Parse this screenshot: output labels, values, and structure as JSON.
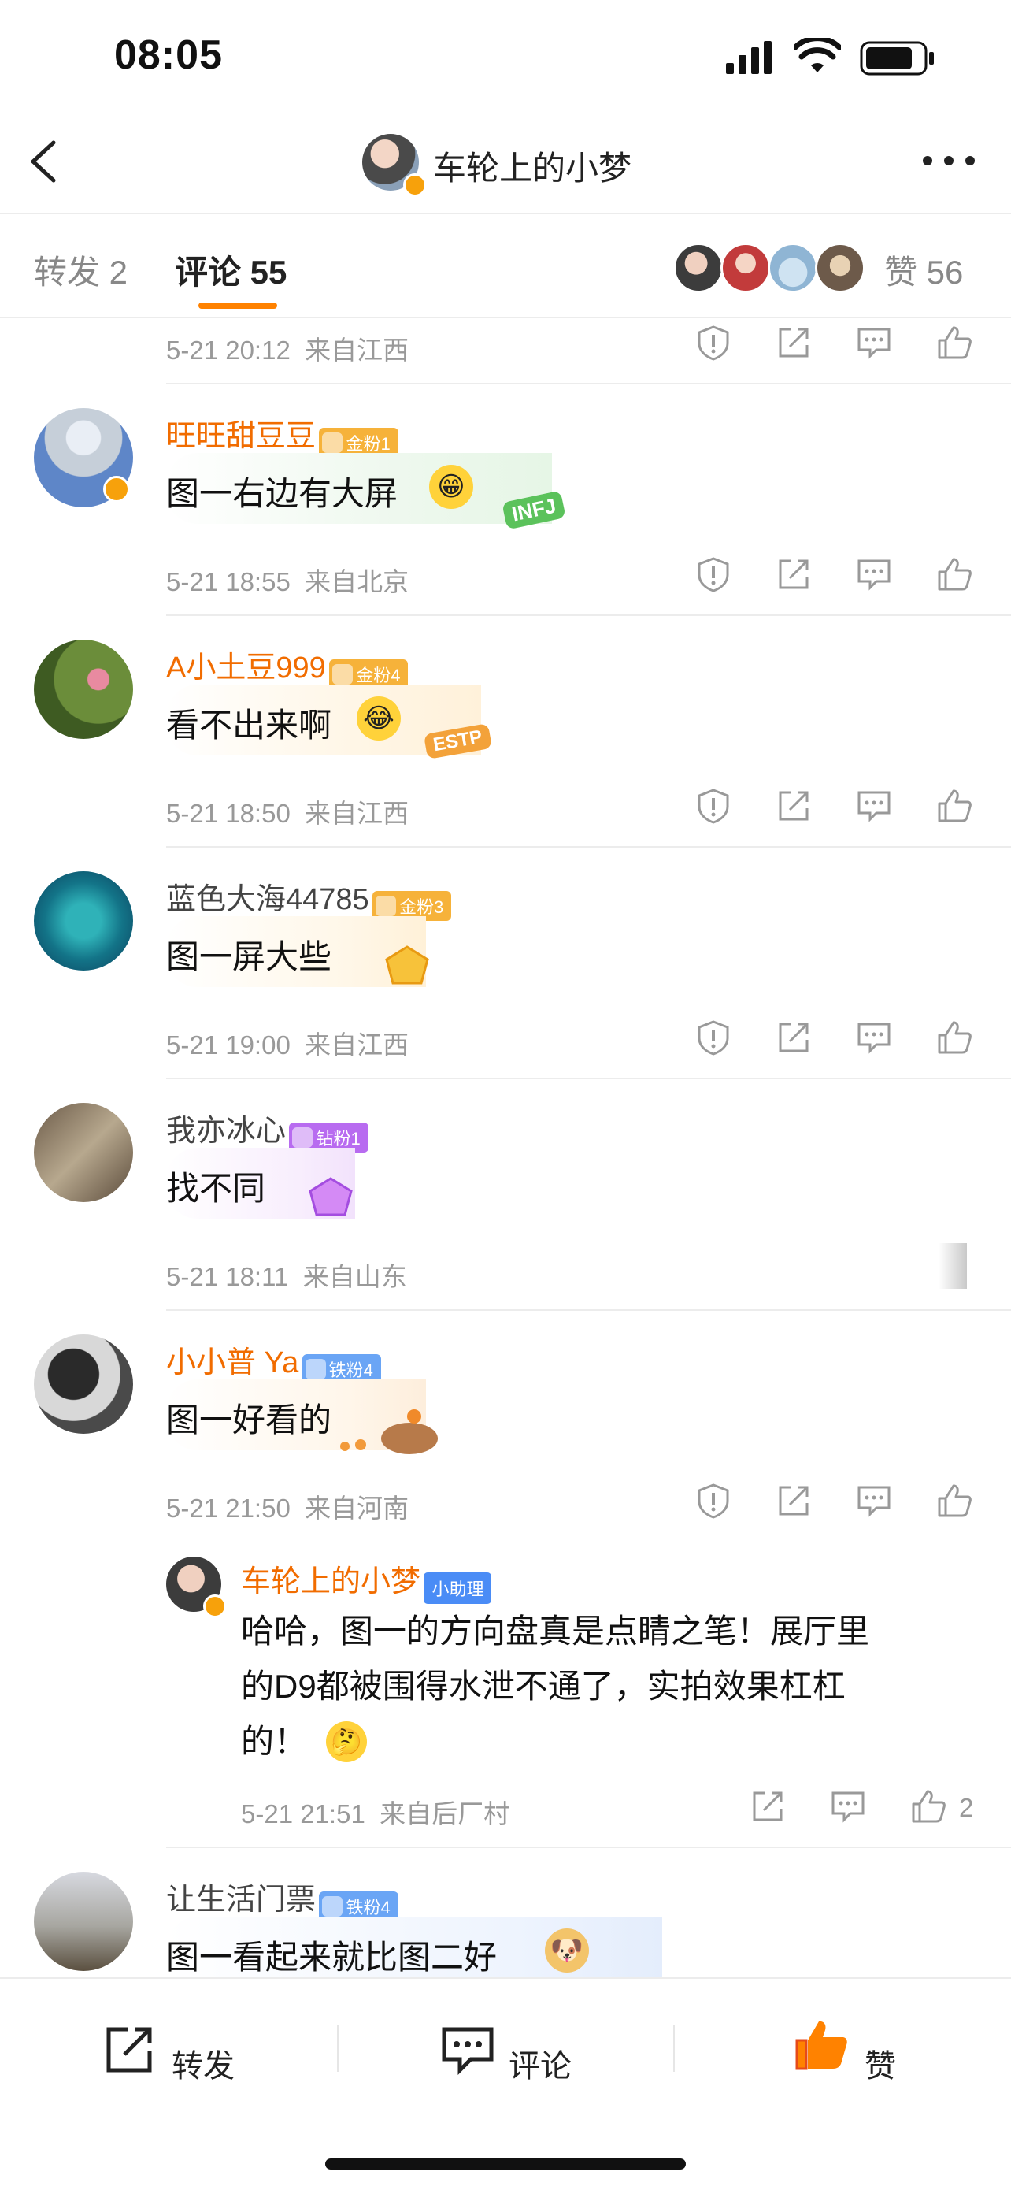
{
  "status": {
    "time": "08:05"
  },
  "header": {
    "title": "车轮上的小梦",
    "back_icon": "chevron-left-icon",
    "more_icon": "more-dots-icon"
  },
  "tabs": [
    {
      "label": "转发 2",
      "active": false
    },
    {
      "label": "评论 55",
      "active": true
    }
  ],
  "likes": {
    "label": "赞 56"
  },
  "top_meta": {
    "time": "5-21 20:12",
    "location": "来自江西"
  },
  "comments": [
    {
      "user": "旺旺甜豆豆",
      "name_color": "orange",
      "badge": "金粉1",
      "text": "图一右边有大屏",
      "emoji": "grinning-face-icon",
      "sticker": "INFJ",
      "time": "5-21 18:55",
      "location": "来自北京"
    },
    {
      "user": "A小土豆999",
      "name_color": "orange",
      "badge": "金粉4",
      "text": "看不出来啊",
      "emoji": "laughing-crying-face-icon",
      "sticker": "ESTP",
      "time": "5-21 18:50",
      "location": "来自江西"
    },
    {
      "user": "蓝色大海44785",
      "name_color": "gray",
      "badge": "金粉3",
      "text": "图一屏大些",
      "emoji": "",
      "sticker": "",
      "time": "5-21 19:00",
      "location": "来自江西"
    },
    {
      "user": "我亦冰心",
      "name_color": "gray",
      "badge": "钻粉1",
      "text": "找不同",
      "emoji": "",
      "sticker": "",
      "time": "5-21 18:11",
      "location": "来自山东"
    },
    {
      "user": "小小普 Ya",
      "name_color": "orange",
      "badge": "铁粉4",
      "text": "图一好看的",
      "emoji": "",
      "sticker": "",
      "time": "5-21 21:50",
      "location": "来自河南"
    },
    {
      "user": "让生活门票",
      "name_color": "gray",
      "badge": "铁粉4",
      "text": "图一看起来就比图二好",
      "emoji": "doge-icon",
      "sticker": "",
      "time": "",
      "location": ""
    }
  ],
  "reply": {
    "user": "车轮上的小梦",
    "badge": "小助理",
    "lines": [
      "哈哈，图一的方向盘真是点睛之笔！展厅里",
      "的D9都被围得水泄不通了，实拍效果杠杠",
      "的！"
    ],
    "emoji": "thinking-face-icon",
    "time": "5-21 21:51",
    "location": "来自后厂村",
    "like_count": "2"
  },
  "bottom_bar": {
    "forward": "转发",
    "comment": "评论",
    "like": "赞"
  },
  "colors": {
    "accent": "#ff8200",
    "orange_name": "#f16c00",
    "meta": "#999999"
  }
}
